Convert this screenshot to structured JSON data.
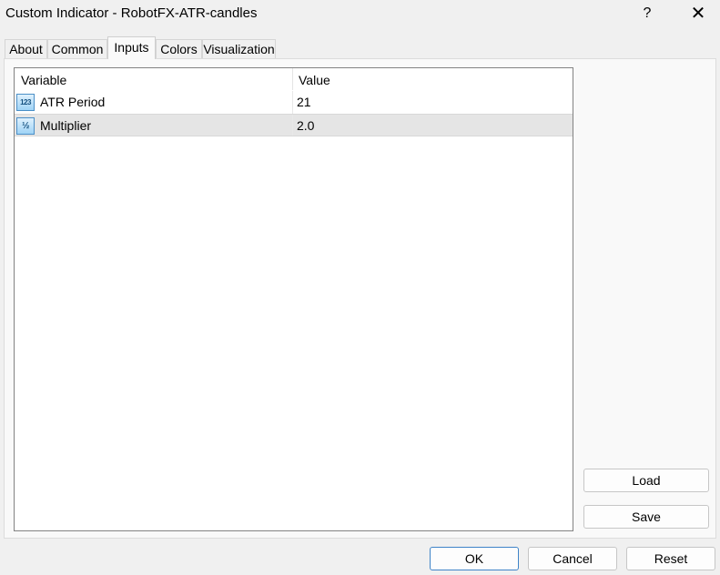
{
  "window": {
    "title": "Custom Indicator - RobotFX-ATR-candles",
    "help_label": "?",
    "close_label": "✕"
  },
  "tabs": [
    {
      "label": "About"
    },
    {
      "label": "Common"
    },
    {
      "label": "Inputs",
      "active": true
    },
    {
      "label": "Colors"
    },
    {
      "label": "Visualization"
    }
  ],
  "table": {
    "columns": [
      "Variable",
      "Value"
    ],
    "rows": [
      {
        "icon": "integer-icon",
        "icon_text": "123",
        "variable": "ATR Period",
        "value": "21"
      },
      {
        "icon": "fraction-icon",
        "icon_text": "½",
        "variable": "Multiplier",
        "value": "2.0",
        "selected": true
      }
    ]
  },
  "side_buttons": {
    "load_label": "Load",
    "save_label": "Save"
  },
  "footer": {
    "ok_label": "OK",
    "cancel_label": "Cancel",
    "reset_label": "Reset"
  }
}
